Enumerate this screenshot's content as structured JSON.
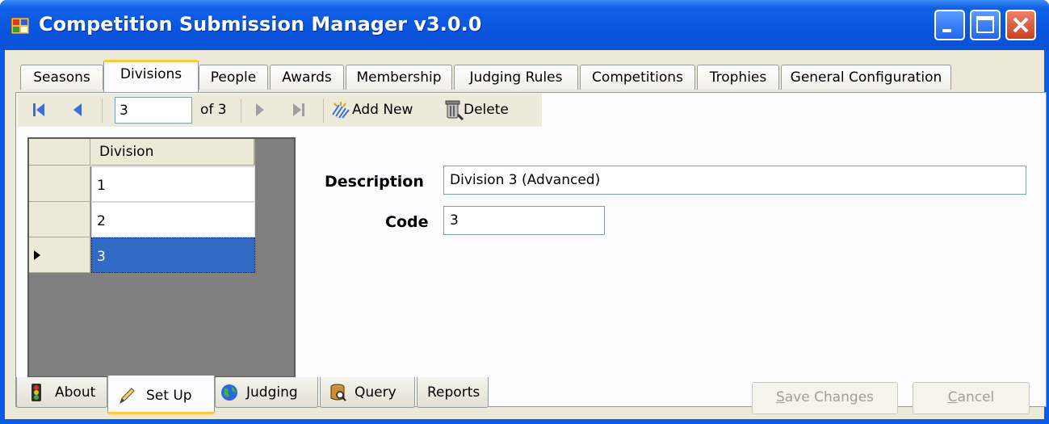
{
  "window": {
    "title": "Competition Submission Manager v3.0.0"
  },
  "top_tabs": [
    "Seasons",
    "Divisions",
    "People",
    "Awards",
    "Membership",
    "Judging Rules",
    "Competitions",
    "Trophies",
    "General Configuration"
  ],
  "top_tabs_selected": "Divisions",
  "navigator": {
    "position": "3",
    "of_label": "of 3",
    "add_new_label": "Add New",
    "delete_label": "Delete"
  },
  "grid": {
    "column_header": "Division",
    "rows": [
      "1",
      "2",
      "3"
    ],
    "selected_row": "3"
  },
  "form": {
    "description_label": "Description",
    "description_value": "Division 3 (Advanced)",
    "code_label": "Code",
    "code_value": "3",
    "save_label": "Save Changes",
    "cancel_label": "Cancel"
  },
  "bottom_tabs": [
    "About",
    "Set Up",
    "Judging",
    "Query",
    "Reports"
  ],
  "bottom_tabs_selected": "Set Up",
  "colors": {
    "title_bar": "#0a54dd",
    "selection": "#316ac5",
    "selected_tab_accent": "#ffc83c"
  }
}
